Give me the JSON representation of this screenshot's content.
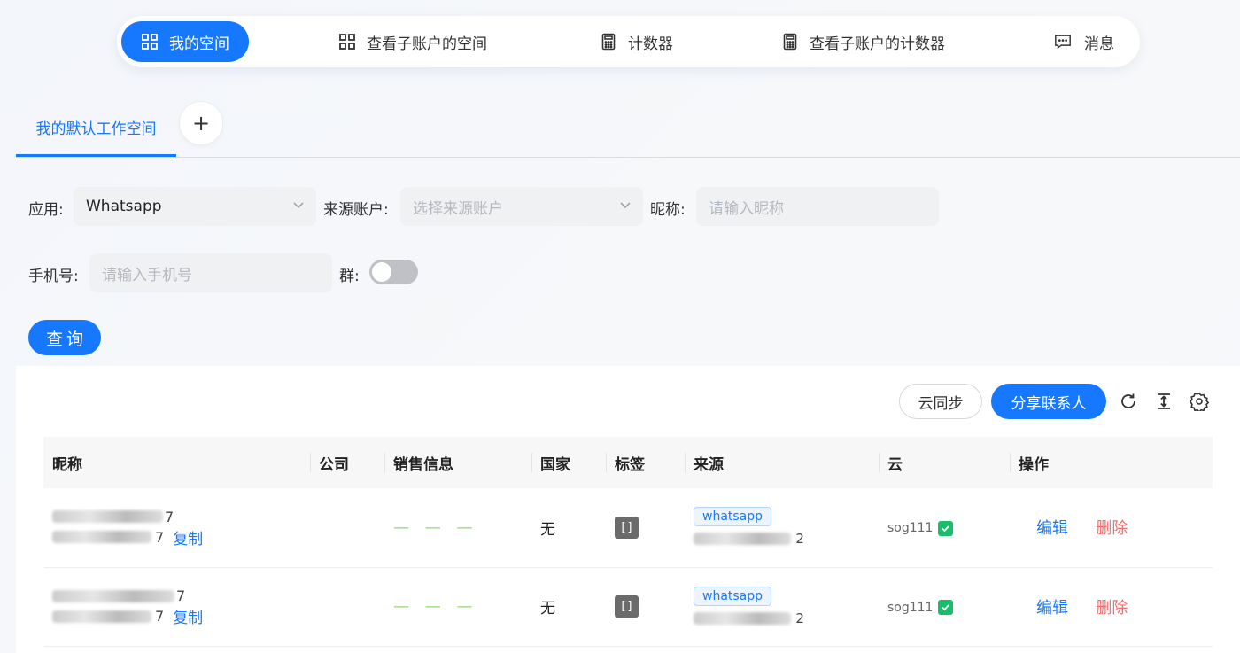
{
  "nav": {
    "items": [
      {
        "label": "我的空间",
        "icon": "grid-icon",
        "active": true
      },
      {
        "label": "查看子账户的空间",
        "icon": "grid-icon",
        "active": false
      },
      {
        "label": "计数器",
        "icon": "calculator-icon",
        "active": false
      },
      {
        "label": "查看子账户的计数器",
        "icon": "calculator-icon",
        "active": false
      },
      {
        "label": "消息",
        "icon": "message-icon",
        "active": false
      }
    ]
  },
  "workspace": {
    "active_tab": "我的默认工作空间",
    "add_label": "+"
  },
  "filters": {
    "app_label": "应用:",
    "app_value": "Whatsapp",
    "source_label": "来源账户:",
    "source_placeholder": "选择来源账户",
    "nickname_label": "昵称:",
    "nickname_placeholder": "请输入昵称",
    "phone_label": "手机号:",
    "phone_placeholder": "请输入手机号",
    "group_label": "群:",
    "group_toggle": false,
    "query_button": "查询"
  },
  "toolbar": {
    "cloud_sync": "云同步",
    "share_contacts": "分享联系人"
  },
  "table": {
    "headers": [
      "昵称",
      "公司",
      "销售信息",
      "国家",
      "标签",
      "来源",
      "云",
      "操作"
    ],
    "rows": [
      {
        "nick_tail": "7",
        "phone_tail": "7",
        "copy": "复制",
        "company": "",
        "sales": "— — —",
        "country": "无",
        "tag": "[]",
        "source": "whatsapp",
        "source_tail": "2",
        "cloud": "sog111",
        "edit": "编辑",
        "delete": "删除"
      },
      {
        "nick_tail": "7",
        "phone_tail": "7",
        "copy": "复制",
        "company": "",
        "sales": "— — —",
        "country": "无",
        "tag": "[]",
        "source": "whatsapp",
        "source_tail": "2",
        "cloud": "sog111",
        "edit": "编辑",
        "delete": "删除"
      }
    ]
  },
  "colors": {
    "primary": "#1677ff",
    "danger": "#f56c6c",
    "success": "#19be6b",
    "dash": "#95d475"
  }
}
